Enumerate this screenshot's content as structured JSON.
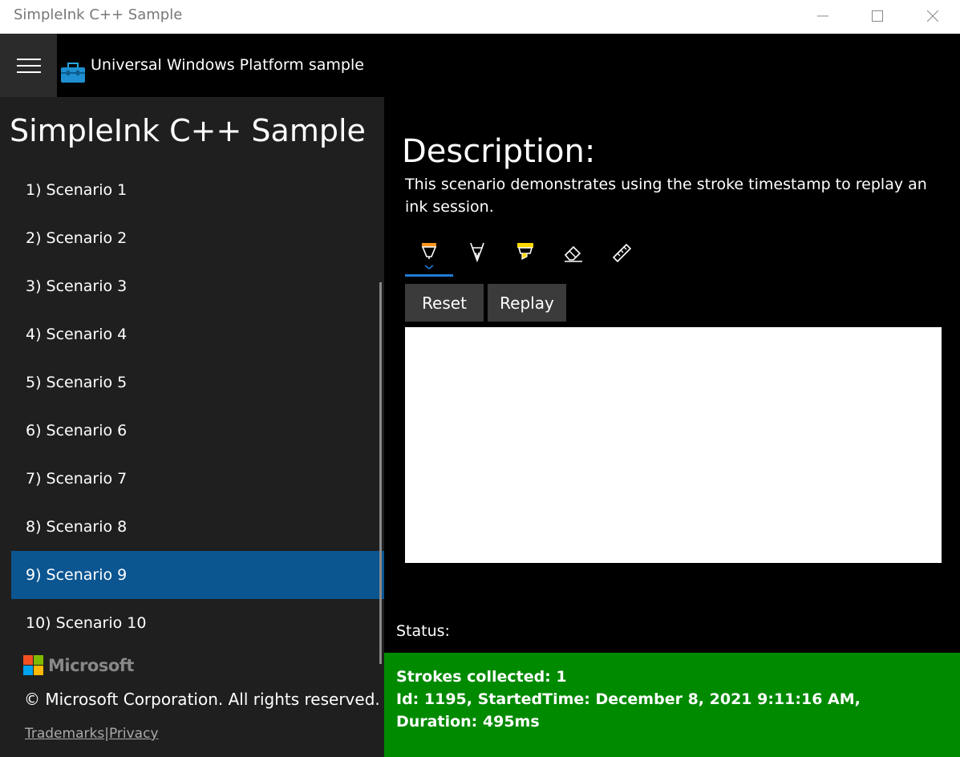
{
  "window": {
    "title": "SimpleInk C++ Sample"
  },
  "header": {
    "app_title": "Universal Windows Platform sample"
  },
  "sidebar": {
    "heading": "SimpleInk C++ Sample",
    "items": [
      {
        "label": "1) Scenario 1"
      },
      {
        "label": "2) Scenario 2"
      },
      {
        "label": "3) Scenario 3"
      },
      {
        "label": "4) Scenario 4"
      },
      {
        "label": "5) Scenario 5"
      },
      {
        "label": "6) Scenario 6"
      },
      {
        "label": "7) Scenario 7"
      },
      {
        "label": "8) Scenario 8"
      },
      {
        "label": "9) Scenario 9"
      },
      {
        "label": "10) Scenario 10"
      }
    ],
    "selected_index": 8,
    "brand": "Microsoft",
    "copyright": "© Microsoft Corporation. All rights reserved.",
    "links": {
      "trademarks": "Trademarks",
      "separator": "|",
      "privacy": "Privacy"
    }
  },
  "main": {
    "description_heading": "Description:",
    "description": "This scenario demonstrates using the stroke timestamp to replay an ink session.",
    "toolbar": [
      "ballpoint-pen-icon",
      "pencil-icon",
      "highlighter-icon",
      "eraser-icon",
      "ruler-icon"
    ],
    "buttons": {
      "reset": "Reset",
      "replay": "Replay"
    },
    "status_label": "Status:",
    "status": {
      "line1": "Strokes collected: 1",
      "line2": "Id: 1195, StartedTime: December 8, 2021 9:11:16 AM, Duration: 495ms"
    }
  },
  "colors": {
    "selected_nav": "#0b5591",
    "status_ok": "#008a00",
    "accent": "#1f7ad4"
  }
}
